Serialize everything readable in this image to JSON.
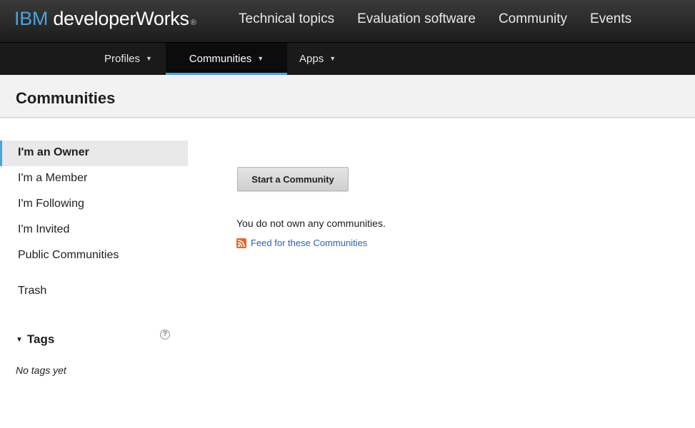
{
  "masthead": {
    "brand_ibm": "IBM",
    "brand_name": "developerWorks",
    "brand_reg": "®",
    "nav": [
      "Technical topics",
      "Evaluation software",
      "Community",
      "Events"
    ]
  },
  "subnav": {
    "profiles": "Profiles",
    "communities": "Communities",
    "apps": "Apps"
  },
  "page": {
    "title": "Communities"
  },
  "sidebar": {
    "items": [
      "I'm an Owner",
      "I'm a Member",
      "I'm Following",
      "I'm Invited",
      "Public Communities"
    ],
    "trash": "Trash",
    "tags_title": "Tags",
    "help_glyph": "?",
    "no_tags": "No tags yet"
  },
  "main": {
    "start_button": "Start a Community",
    "empty_message": "You do not own any communities.",
    "feed_link": "Feed for these Communities"
  },
  "colors": {
    "accent": "#4aa3df",
    "link": "#2a62b3",
    "rss": "#e2692a"
  }
}
